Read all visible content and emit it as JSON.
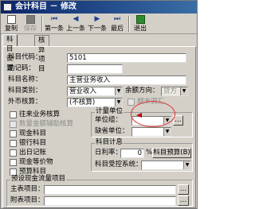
{
  "window": {
    "title": "会计科目 － 修改"
  },
  "toolbar": {
    "items": [
      {
        "label": "复制",
        "icon": "copy-icon",
        "enabled": true
      },
      {
        "label": "保存",
        "icon": "save-icon",
        "enabled": false
      },
      {
        "label": "第一条",
        "icon": "first-icon",
        "enabled": true
      },
      {
        "label": "上一条",
        "icon": "prev-icon",
        "enabled": true
      },
      {
        "label": "下一条",
        "icon": "next-icon",
        "enabled": true
      },
      {
        "label": "最后",
        "icon": "last-icon",
        "enabled": true
      },
      {
        "label": "退出",
        "icon": "exit-icon",
        "enabled": true
      }
    ]
  },
  "tabs": [
    {
      "label": "科目设置"
    },
    {
      "label": "核算项目"
    }
  ],
  "form": {
    "code_label": "科目代码：",
    "code_value": "5101",
    "mnemonic_label": "助记码：",
    "mnemonic_value": "",
    "name_label": "科目名称：",
    "name_value": "主营业务收入",
    "category_label": "科目类别：",
    "category_value": "营业收入",
    "balance_label": "余额方向：",
    "balance_value": "贷方",
    "currency_label": "外币核算：",
    "currency_value": "(不核算)",
    "adjust_label": "期末调汇"
  },
  "checkboxes": [
    {
      "label": "往来业务核算"
    },
    {
      "label": "数量金额辅助核算"
    },
    {
      "label": "现金科目"
    },
    {
      "label": "银行科目"
    },
    {
      "label": "出日记账"
    },
    {
      "label": "现金等价物"
    },
    {
      "label": "预算科目"
    }
  ],
  "unit_group": {
    "title": "计量单位",
    "unit_group_label": "单位组：",
    "unit_group_value": "",
    "default_unit_label": "缺省单位：",
    "default_unit_value": ""
  },
  "schedule_group": {
    "title": "科目计息",
    "daily_rate_label": "日利率：",
    "daily_rate_value": "0",
    "percent": "%",
    "budget_button": "科目预算(B)",
    "subject_ctrl_label": "科目受控系统：",
    "subject_ctrl_value": ""
  },
  "cash_group": {
    "title": "预设现金流量项目",
    "main_label": "主表项目：",
    "main_value": "",
    "attach_label": "附表项目：",
    "attach_value": ""
  }
}
